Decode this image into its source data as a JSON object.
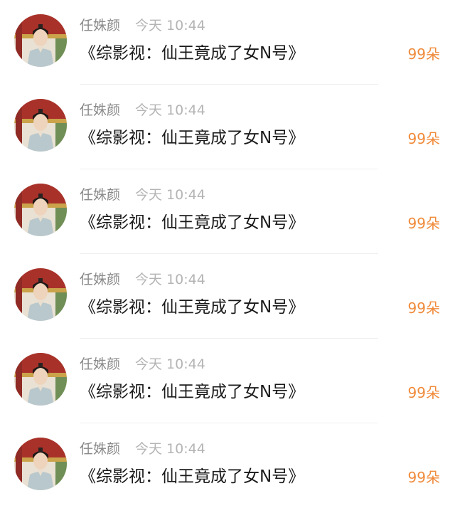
{
  "items": [
    {
      "name": "任姝颜",
      "time": "今天 10:44",
      "title": "《综影视：仙王竟成了女N号》",
      "gift": "99朵"
    },
    {
      "name": "任姝颜",
      "time": "今天 10:44",
      "title": "《综影视：仙王竟成了女N号》",
      "gift": "99朵"
    },
    {
      "name": "任姝颜",
      "time": "今天 10:44",
      "title": "《综影视：仙王竟成了女N号》",
      "gift": "99朵"
    },
    {
      "name": "任姝颜",
      "time": "今天 10:44",
      "title": "《综影视：仙王竟成了女N号》",
      "gift": "99朵"
    },
    {
      "name": "任姝颜",
      "time": "今天 10:44",
      "title": "《综影视：仙王竟成了女N号》",
      "gift": "99朵"
    },
    {
      "name": "任姝颜",
      "time": "今天 10:44",
      "title": "《综影视：仙王竟成了女N号》",
      "gift": "99朵"
    }
  ],
  "colors": {
    "name": "#8a8a8a",
    "time": "#b4b4b4",
    "title": "#1a1a1a",
    "gift_accent": "#f08a3a",
    "divider": "#efefef"
  }
}
